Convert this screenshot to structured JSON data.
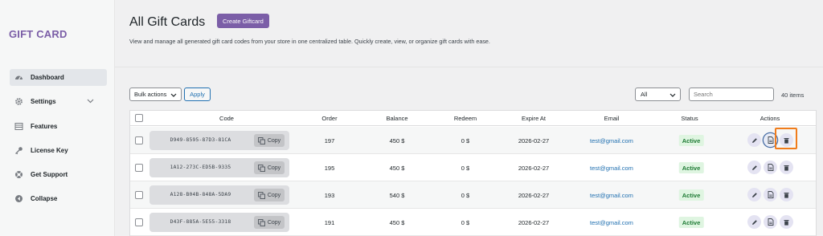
{
  "sidebar": {
    "brand": "GIFT CARD",
    "items": [
      {
        "label": "Dashboard",
        "icon": "dashboard-icon",
        "active": true
      },
      {
        "label": "Settings",
        "icon": "gear-icon",
        "has_chevron": true
      },
      {
        "label": "Features",
        "icon": "list-icon"
      },
      {
        "label": "License Key",
        "icon": "key-icon"
      },
      {
        "label": "Get Support",
        "icon": "support-icon"
      },
      {
        "label": "Collapse",
        "icon": "collapse-icon"
      }
    ]
  },
  "header": {
    "title": "All Gift Cards",
    "create_label": "Create Giftcard",
    "description": "View and manage all generated gift card codes from your store in one centralized table. Quickly create, view, or organize gift cards with ease."
  },
  "toolbar": {
    "bulk_value": "Bulk actions",
    "apply_label": "Apply",
    "filter_value": "All",
    "search_placeholder": "Search",
    "items_count": "40 items"
  },
  "table": {
    "columns": [
      "Code",
      "Order",
      "Balance",
      "Redeem",
      "Expire At",
      "Email",
      "Status",
      "Actions"
    ],
    "copy_label": "Copy",
    "rows": [
      {
        "code": "D949-8595-87D3-81CA",
        "order": "197",
        "balance": "450 $",
        "redeem": "0 $",
        "expire": "2026-02-27",
        "email": "test@gmail.com",
        "status": "Active"
      },
      {
        "code": "1A12-273C-ED5B-9335",
        "order": "195",
        "balance": "450 $",
        "redeem": "0 $",
        "expire": "2026-02-27",
        "email": "test@gmail.com",
        "status": "Active"
      },
      {
        "code": "A128-B04B-848A-5DA9",
        "order": "193",
        "balance": "540 $",
        "redeem": "0 $",
        "expire": "2026-02-27",
        "email": "test@gmail.com",
        "status": "Active"
      },
      {
        "code": "D43F-885A-5E55-3318",
        "order": "191",
        "balance": "450 $",
        "redeem": "0 $",
        "expire": "2026-02-27",
        "email": "test@gmail.com",
        "status": "Active"
      }
    ]
  },
  "colors": {
    "accent": "#7b5ea7",
    "link": "#2271b1",
    "status_active_bg": "#dff5e1",
    "status_active_text": "#1e7a34",
    "highlight": "#f07c1b"
  }
}
